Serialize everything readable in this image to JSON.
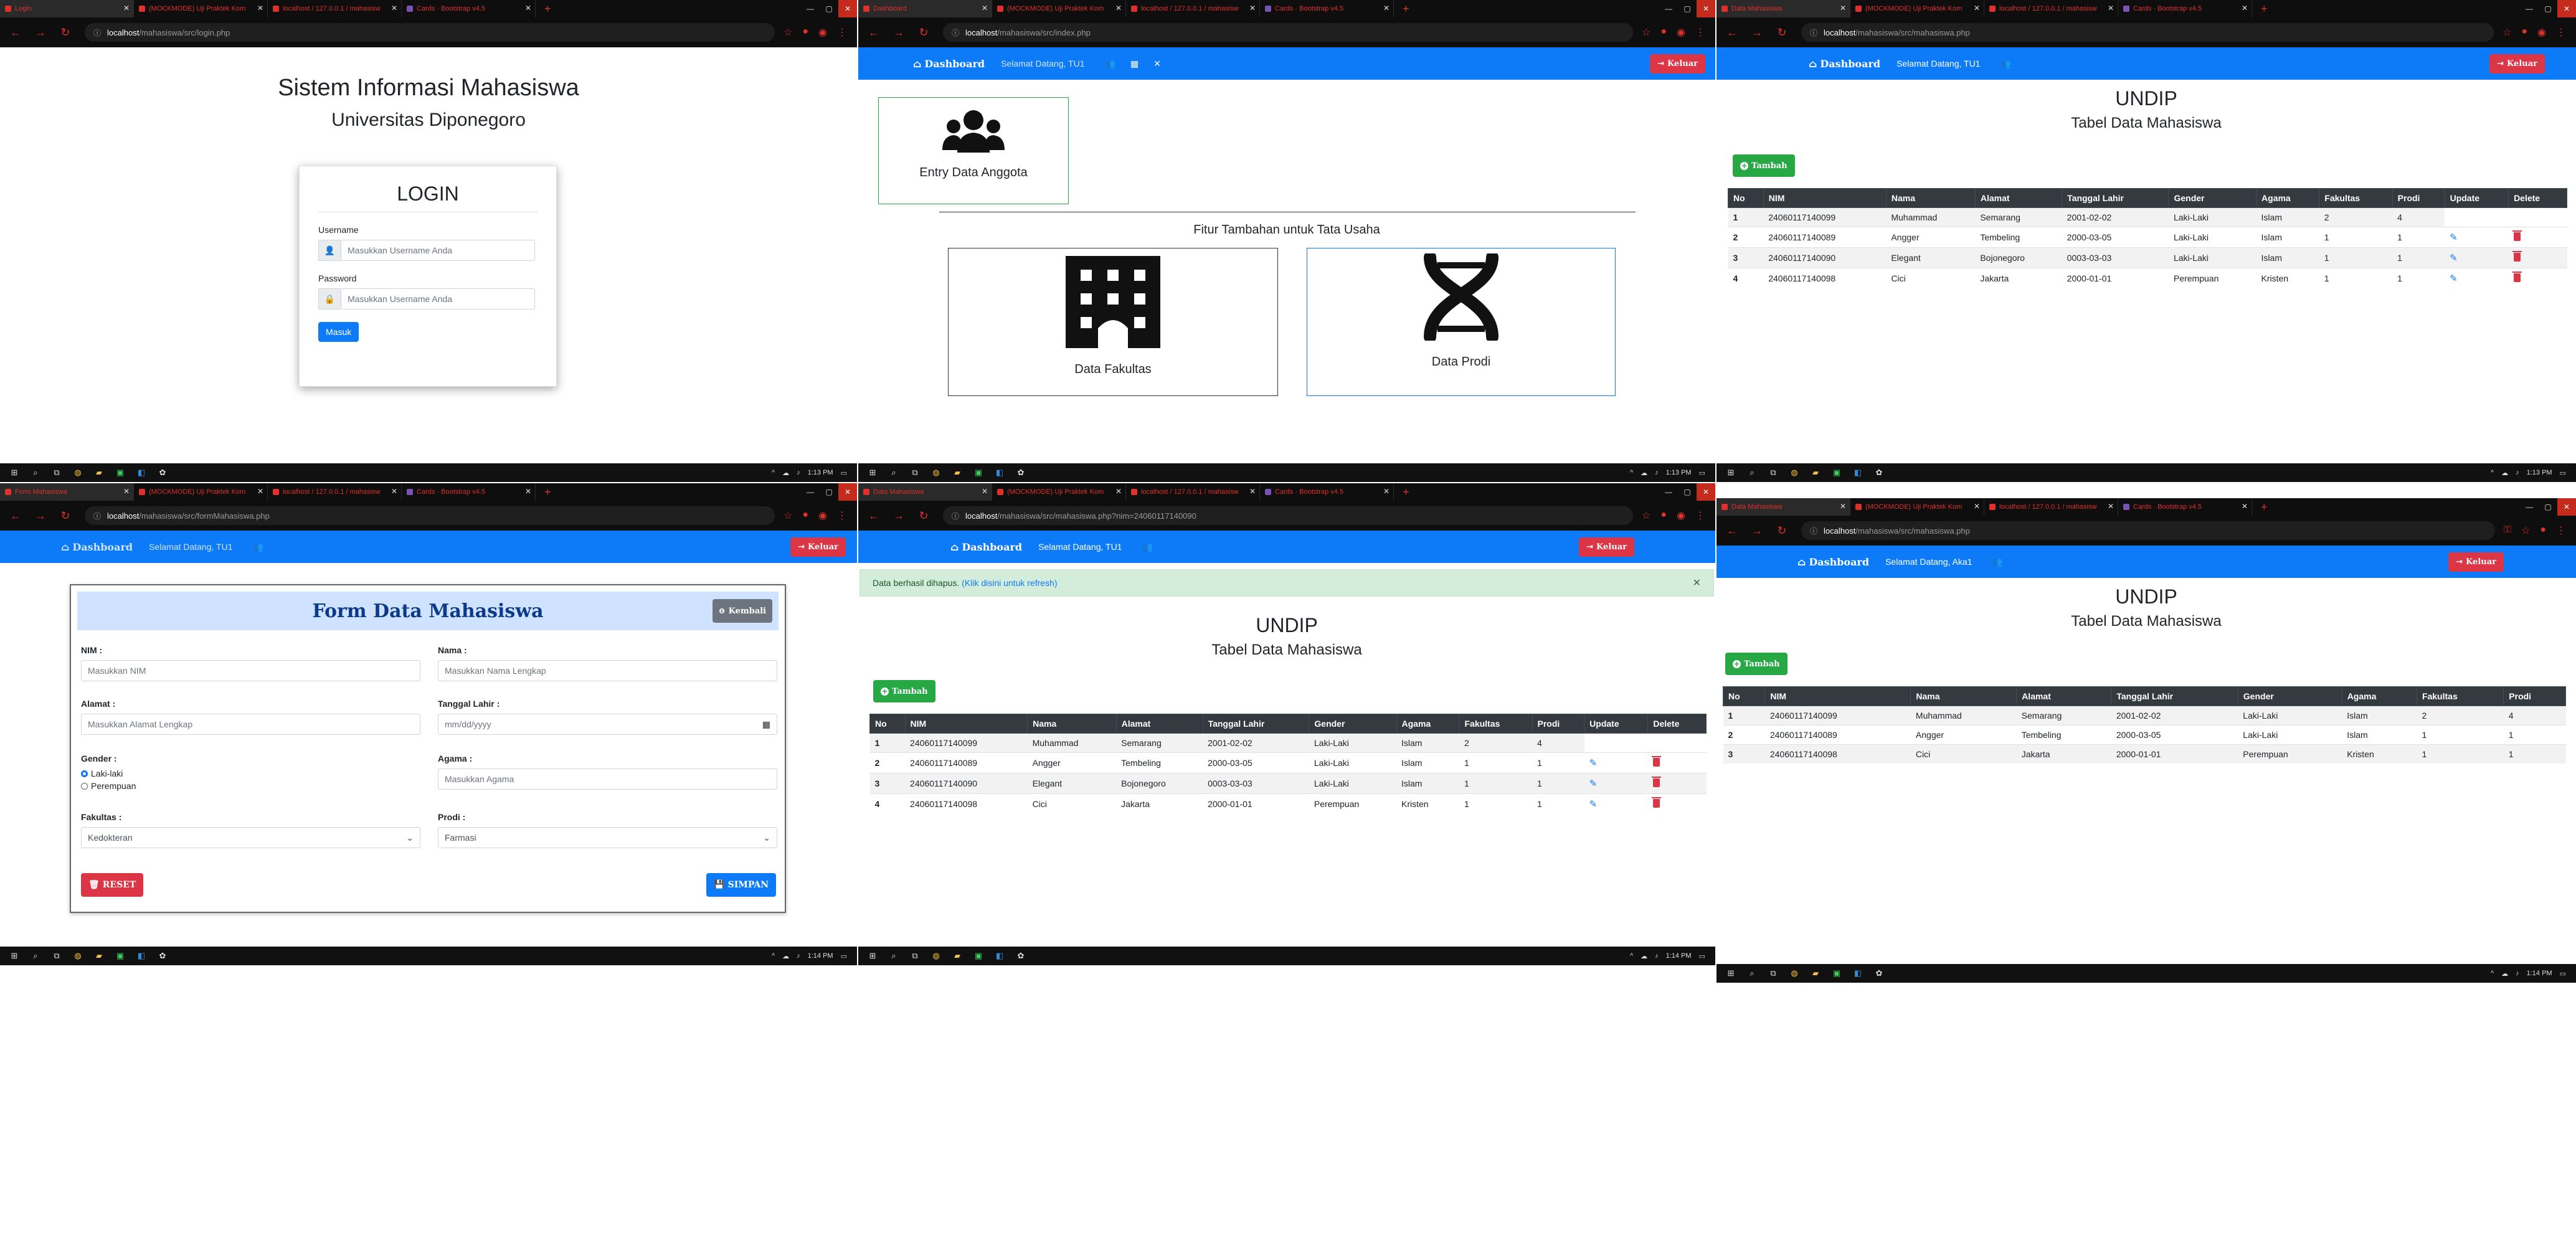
{
  "tabs": {
    "login": "Login",
    "dashboard": "Dashboard",
    "form": "Form Mahasiswa",
    "data": "Data Mahasiswa",
    "t2": "(MOCKMODE) Uji Praktek Kom",
    "t3": "localhost / 127.0.0.1 / mahasisw",
    "t4": "Cards · Bootstrap v4.5"
  },
  "urls": {
    "login": {
      "host": "localhost",
      "path": "/mahasiswa/src/login.php"
    },
    "dashboard": {
      "host": "localhost",
      "path": "/mahasiswa/src/index.php"
    },
    "list": {
      "host": "localhost",
      "path": "/mahasiswa/src/mahasiswa.php"
    },
    "form": {
      "host": "localhost",
      "path": "/mahasiswa/src/formMahasiswa.php"
    },
    "deleted": {
      "host": "localhost",
      "path": "/mahasiswa/src/mahasiswa.php?nim=24060117140090"
    }
  },
  "clock": {
    "t1": "1:13 PM",
    "t2": "1:14 PM"
  },
  "login": {
    "title": "Sistem Informasi Mahasiswa",
    "subtitle": "Universitas Diponegoro",
    "card_title": "LOGIN",
    "username_label": "Username",
    "username_placeholder": "Masukkan Username Anda",
    "password_label": "Password",
    "password_placeholder": "Masukkan Username Anda",
    "submit": "Masuk"
  },
  "nav": {
    "brand": "Dashboard",
    "welcome_tu": "Selamat Datang, TU1",
    "welcome_aka": "Selamat Datang, Aka1",
    "logout": "Keluar"
  },
  "dashboard": {
    "entry_card": "Entry Data Anggota",
    "extra_title": "Fitur Tambahan untuk Tata Usaha",
    "fakultas_card": "Data Fakultas",
    "prodi_card": "Data Prodi"
  },
  "list": {
    "title": "UNDIP",
    "subtitle": "Tabel Data Mahasiswa",
    "add": "Tambah",
    "headers": [
      "No",
      "NIM",
      "Nama",
      "Alamat",
      "Tanggal Lahir",
      "Gender",
      "Agama",
      "Fakultas",
      "Prodi",
      "Update",
      "Delete"
    ],
    "headers_ro": [
      "No",
      "NIM",
      "Nama",
      "Alamat",
      "Tanggal Lahir",
      "Gender",
      "Agama",
      "Fakultas",
      "Prodi"
    ],
    "rows_full": [
      [
        "1",
        "24060117140099",
        "Muhammad",
        "Semarang",
        "2001-02-02",
        "Laki-Laki",
        "Islam",
        "2",
        "4"
      ],
      [
        "2",
        "24060117140089",
        "Angger",
        "Tembeling",
        "2000-03-05",
        "Laki-Laki",
        "Islam",
        "1",
        "1"
      ],
      [
        "3",
        "24060117140090",
        "Elegant",
        "Bojonegoro",
        "0003-03-03",
        "Laki-Laki",
        "Islam",
        "1",
        "1"
      ],
      [
        "4",
        "24060117140098",
        "Cici",
        "Jakarta",
        "2000-01-01",
        "Perempuan",
        "Kristen",
        "1",
        "1"
      ]
    ],
    "rows_after": [
      [
        "1",
        "24060117140099",
        "Muhammad",
        "Semarang",
        "2001-02-02",
        "Laki-Laki",
        "Islam",
        "2",
        "4"
      ],
      [
        "2",
        "24060117140089",
        "Angger",
        "Tembeling",
        "2000-03-05",
        "Laki-Laki",
        "Islam",
        "1",
        "1"
      ],
      [
        "3",
        "24060117140098",
        "Cici",
        "Jakarta",
        "2000-01-01",
        "Perempuan",
        "Kristen",
        "1",
        "1"
      ]
    ],
    "alert": "Data berhasil dihapus.",
    "alert_link": "(Klik disini untuk refresh)"
  },
  "form": {
    "title": "Form Data Mahasiswa",
    "back": "Kembali",
    "nim_label": "NIM :",
    "nim_placeholder": "Masukkan NIM",
    "nama_label": "Nama :",
    "nama_placeholder": "Masukkan Nama Lengkap",
    "alamat_label": "Alamat :",
    "alamat_placeholder": "Masukkan Alamat Lengkap",
    "tgl_label": "Tanggal Lahir :",
    "tgl_placeholder": "mm/dd/yyyy",
    "gender_label": "Gender :",
    "gender_male": "Laki-laki",
    "gender_female": "Perempuan",
    "agama_label": "Agama :",
    "agama_placeholder": "Masukkan Agama",
    "fakultas_label": "Fakultas :",
    "fakultas_value": "Kedokteran",
    "prodi_label": "Prodi :",
    "prodi_value": "Farmasi",
    "reset": "RESET",
    "save": "SIMPAN"
  },
  "colors": {
    "primary": "#0d7bf7",
    "danger": "#dc3545",
    "success": "#28a745",
    "dark": "#343a40"
  }
}
